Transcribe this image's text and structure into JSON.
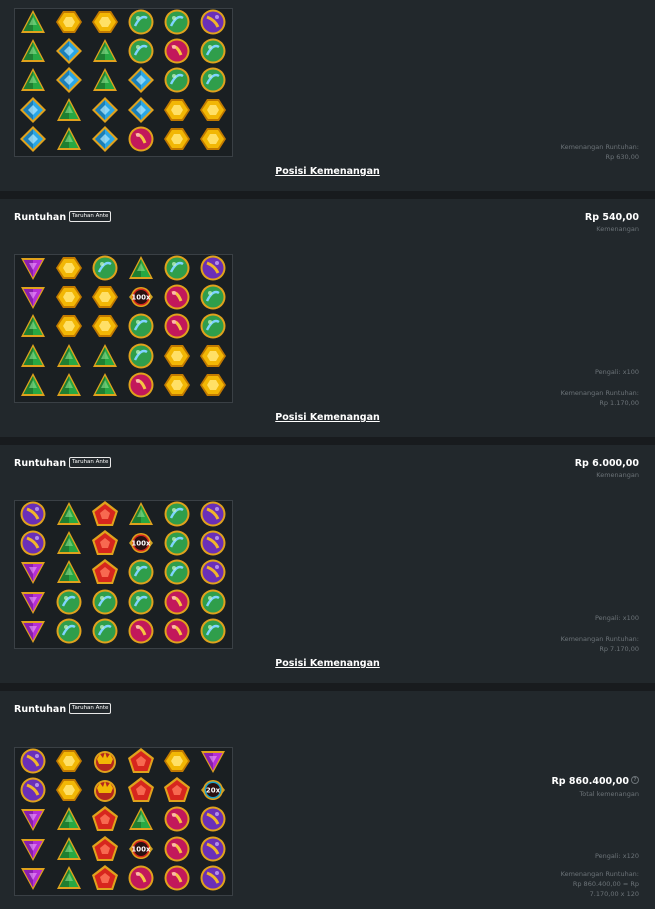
{
  "symbol_colors": {
    "green-triangle": "#27a843",
    "blue-diamond": "#29a6e6",
    "gold-hexagon": "#f2b705",
    "green-orb": "#2f9e4b",
    "red-orb": "#c2185b",
    "purple-orb": "#6a2fb8",
    "purple-triangle": "#b52fd6",
    "red-pentagon": "#d7261e",
    "red-crown": "#b3261e",
    "multiplier": "#8a1010"
  },
  "panels": [
    {
      "link": "Posisi Kemenangan",
      "info_lines": [
        "Kemenangan Runtuhan:",
        "Rp 630,00"
      ],
      "grid": [
        [
          "green-triangle",
          "gold-hexagon",
          "gold-hexagon",
          "green-orb",
          "green-orb",
          "purple-orb"
        ],
        [
          "green-triangle",
          "blue-diamond",
          "green-triangle",
          "green-orb",
          "red-orb",
          "green-orb"
        ],
        [
          "green-triangle",
          "blue-diamond",
          "green-triangle",
          "blue-diamond",
          "green-orb",
          "green-orb"
        ],
        [
          "blue-diamond",
          "green-triangle",
          "blue-diamond",
          "blue-diamond",
          "gold-hexagon",
          "gold-hexagon"
        ],
        [
          "blue-diamond",
          "green-triangle",
          "blue-diamond",
          "red-orb",
          "gold-hexagon",
          "gold-hexagon"
        ]
      ]
    },
    {
      "title": "Runtuhan",
      "badge": "Taruhan Ante",
      "amount": "Rp 540,00",
      "amount_sub": "Kemenangan",
      "multiplier_line": "Pengali: x100",
      "info_lines": [
        "Kemenangan Runtuhan:",
        "Rp 1.170,00"
      ],
      "link": "Posisi Kemenangan",
      "multiplier_label": "100x",
      "grid": [
        [
          "purple-triangle",
          "gold-hexagon",
          "green-orb",
          "green-triangle",
          "green-orb",
          "purple-orb"
        ],
        [
          "purple-triangle",
          "gold-hexagon",
          "gold-hexagon",
          "multiplier",
          "red-orb",
          "green-orb"
        ],
        [
          "green-triangle",
          "gold-hexagon",
          "gold-hexagon",
          "green-orb",
          "red-orb",
          "green-orb"
        ],
        [
          "green-triangle",
          "green-triangle",
          "green-triangle",
          "green-orb",
          "gold-hexagon",
          "gold-hexagon"
        ],
        [
          "green-triangle",
          "green-triangle",
          "green-triangle",
          "red-orb",
          "gold-hexagon",
          "gold-hexagon"
        ]
      ]
    },
    {
      "title": "Runtuhan",
      "badge": "Taruhan Ante",
      "amount": "Rp 6.000,00",
      "amount_sub": "Kemenangan",
      "multiplier_line": "Pengali: x100",
      "info_lines": [
        "Kemenangan Runtuhan:",
        "Rp 7.170,00"
      ],
      "link": "Posisi Kemenangan",
      "multiplier_label": "100x",
      "grid": [
        [
          "purple-orb",
          "green-triangle",
          "red-pentagon",
          "green-triangle",
          "green-orb",
          "purple-orb"
        ],
        [
          "purple-orb",
          "green-triangle",
          "red-pentagon",
          "multiplier",
          "green-orb",
          "purple-orb"
        ],
        [
          "purple-triangle",
          "green-triangle",
          "red-pentagon",
          "green-orb",
          "green-orb",
          "purple-orb"
        ],
        [
          "purple-triangle",
          "green-orb",
          "green-orb",
          "green-orb",
          "red-orb",
          "green-orb"
        ],
        [
          "purple-triangle",
          "green-orb",
          "green-orb",
          "red-orb",
          "red-orb",
          "green-orb"
        ]
      ]
    },
    {
      "title": "Runtuhan",
      "badge": "Taruhan Ante",
      "amount": "Rp 860.400,00",
      "amount_sub": "Total kemenangan",
      "multiplier_line": "Pengali: x120",
      "info_lines": [
        "Kemenangan Runtuhan:",
        "Rp 860.400,00 = Rp",
        "7.170,00 x 120"
      ],
      "multiplier_label": "100x",
      "multiplier_label_2": "20x",
      "grid": [
        [
          "purple-orb",
          "gold-hexagon",
          "red-crown",
          "red-pentagon",
          "gold-hexagon",
          "purple-triangle"
        ],
        [
          "purple-orb",
          "gold-hexagon",
          "red-crown",
          "red-pentagon",
          "red-pentagon",
          "multiplier-2"
        ],
        [
          "purple-triangle",
          "green-triangle",
          "red-pentagon",
          "green-triangle",
          "red-orb",
          "purple-orb"
        ],
        [
          "purple-triangle",
          "green-triangle",
          "red-pentagon",
          "multiplier",
          "red-orb",
          "purple-orb"
        ],
        [
          "purple-triangle",
          "green-triangle",
          "red-pentagon",
          "red-orb",
          "red-orb",
          "purple-orb"
        ]
      ]
    }
  ]
}
